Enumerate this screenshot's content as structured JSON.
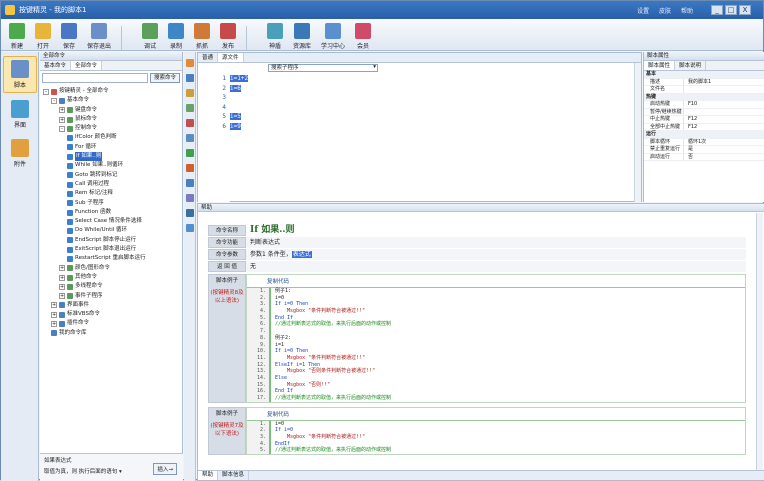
{
  "window": {
    "title": "按键精灵 - 我的脚本1",
    "top_links": [
      "设置",
      "皮肤",
      "帮助"
    ],
    "buttons": [
      "_",
      "□",
      "X"
    ]
  },
  "toolbar": {
    "items": [
      "新建",
      "打开",
      "保存",
      "保存退出",
      "调试",
      "录制",
      "抓抓",
      "发布",
      "神盾",
      "资源库",
      "学习中心",
      "会员"
    ]
  },
  "leftbar": {
    "items": [
      "脚本",
      "界面",
      "附件"
    ]
  },
  "cmd_panel": {
    "title": "全部命令",
    "tabs": [
      "基本命令",
      "全部命令"
    ],
    "search_button": "搜索命令",
    "tree": [
      {
        "level": 0,
        "exp": "-",
        "text": "按键精灵 - 全部命令"
      },
      {
        "level": 1,
        "exp": "-",
        "text": "基本命令"
      },
      {
        "level": 2,
        "exp": "+",
        "text": "键盘命令"
      },
      {
        "level": 2,
        "exp": "+",
        "text": "鼠标命令"
      },
      {
        "level": 2,
        "exp": "-",
        "text": "控制命令"
      },
      {
        "level": 3,
        "exp": "",
        "text": "IfColor 颜色判断"
      },
      {
        "level": 3,
        "exp": "",
        "text": "For 循环"
      },
      {
        "level": 3,
        "exp": "",
        "text": "If 如果..则",
        "selected": true
      },
      {
        "level": 3,
        "exp": "",
        "text": "While 如果..则循环"
      },
      {
        "level": 3,
        "exp": "",
        "text": "Goto 跳转到标记"
      },
      {
        "level": 3,
        "exp": "",
        "text": "Call 调用过程"
      },
      {
        "level": 3,
        "exp": "",
        "text": "Rem 标记/注释"
      },
      {
        "level": 3,
        "exp": "",
        "text": "Sub 子程序"
      },
      {
        "level": 3,
        "exp": "",
        "text": "Function 函数"
      },
      {
        "level": 3,
        "exp": "",
        "text": "Select Case 情况条件选择"
      },
      {
        "level": 3,
        "exp": "",
        "text": "Do While/Until 循环"
      },
      {
        "level": 3,
        "exp": "",
        "text": "EndScript 脚本停止运行"
      },
      {
        "level": 3,
        "exp": "",
        "text": "ExitScript 脚本退出运行"
      },
      {
        "level": 3,
        "exp": "",
        "text": "RestartScript 重启脚本运行"
      },
      {
        "level": 2,
        "exp": "+",
        "text": "颜色/图形命令"
      },
      {
        "level": 2,
        "exp": "+",
        "text": "其他命令"
      },
      {
        "level": 2,
        "exp": "+",
        "text": "多线程命令"
      },
      {
        "level": 2,
        "exp": "+",
        "text": "事件子程序"
      },
      {
        "level": 1,
        "exp": "+",
        "text": "界面事件"
      },
      {
        "level": 1,
        "exp": "+",
        "text": "标准VBS命令"
      },
      {
        "level": 1,
        "exp": "+",
        "text": "插件命令"
      },
      {
        "level": 1,
        "exp": "",
        "text": "我的命令库"
      }
    ],
    "footer_line1": "如果表达式",
    "footer_line2": "取值为真，则 执行后面的语句 ▾",
    "insert_button": "插入→"
  },
  "editor": {
    "tabs": [
      "普通",
      "源文件"
    ],
    "dropdown": "搜索子程序",
    "lines": [
      "1",
      "2",
      "3",
      "4",
      "5",
      "6"
    ],
    "code": [
      "i=1+2",
      "i=6",
      "",
      "",
      "i=5",
      "i=9"
    ]
  },
  "props": {
    "title": "脚本属性",
    "tabs": [
      "脚本属性",
      "脚本说明"
    ],
    "rows": [
      {
        "grp": true,
        "k": "基本",
        "v": ""
      },
      {
        "k": "描述",
        "v": "我的脚本1"
      },
      {
        "k": "文件名",
        "v": ""
      },
      {
        "grp": true,
        "k": "热键",
        "v": ""
      },
      {
        "k": "启动热键",
        "v": "F10"
      },
      {
        "k": "暂停/继续热键",
        "v": ""
      },
      {
        "k": "中止热键",
        "v": "F12"
      },
      {
        "k": "全部中止热键",
        "v": "F12"
      },
      {
        "grp": true,
        "k": "运行",
        "v": ""
      },
      {
        "k": "脚本循环",
        "v": "循环1次"
      },
      {
        "k": "禁止重复运行",
        "v": "是"
      },
      {
        "k": "启动运行",
        "v": "否"
      }
    ]
  },
  "help": {
    "title": "帮助",
    "rows": [
      {
        "lab": "命令名称",
        "val": "If 如果..则"
      },
      {
        "lab": "命令功能",
        "val": "判断表达式"
      },
      {
        "lab": "命令参数",
        "val_pre": "参数1 条件型，",
        "val_hl": "表达式"
      },
      {
        "lab": "返 回 值",
        "val": "无"
      }
    ],
    "ex1": {
      "lab": "脚本例子",
      "red": "(按键精灵8及以上语法)",
      "copy": "复制代码",
      "lines": [
        [
          "例子1:",
          "n"
        ],
        [
          "i=0",
          "n"
        ],
        [
          "If i=0 Then",
          "kw"
        ],
        [
          "    Msgbox \"条件判断符合被通过!!\"",
          "str"
        ],
        [
          "End If",
          "kw"
        ],
        [
          "//通过判断表达式的取值，来执行后面的动作或控制",
          "cm"
        ],
        [
          "",
          "n"
        ],
        [
          "例子2:",
          "n"
        ],
        [
          "i=1",
          "n"
        ],
        [
          "If i=0 Then",
          "kw"
        ],
        [
          "    Msgbox \"条件判断符合被通过!!\"",
          "str"
        ],
        [
          "ElseIf i=1 Then",
          "kw"
        ],
        [
          "    Msgbox \"否则条件判断符合被通过!!\"",
          "str"
        ],
        [
          "Else",
          "kw"
        ],
        [
          "    Msgbox \"否则!!\"",
          "str"
        ],
        [
          "End If",
          "kw"
        ],
        [
          "//通过判断表达式的取值，来执行后面的动作或控制",
          "cm"
        ]
      ]
    },
    "ex2": {
      "lab": "脚本例子",
      "red": "(按键精灵7及以下语法)",
      "copy": "复制代码",
      "lines": [
        [
          "i=0",
          "n"
        ],
        [
          "If i=0",
          "kw"
        ],
        [
          "    Msgbox \"条件判断符合被通过!!\"",
          "str"
        ],
        [
          "EndIf",
          "kw"
        ],
        [
          "//通过判断表达式的取值，来执行后面的动作或控制",
          "cm"
        ]
      ]
    },
    "bottom_tabs": [
      "帮助",
      "脚本信息"
    ]
  },
  "colors": {
    "title_bar": "#2a5fa8",
    "selection": "#3b6fd4",
    "accent": "#f4c542"
  }
}
